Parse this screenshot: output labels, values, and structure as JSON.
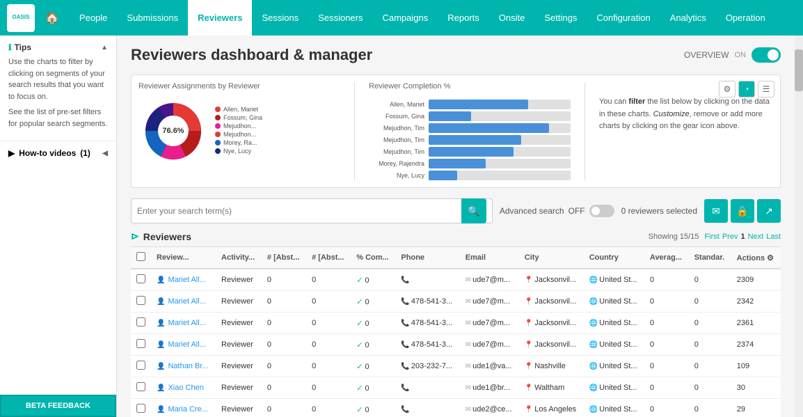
{
  "nav": {
    "logo": "OASIS",
    "home_icon": "🏠",
    "items": [
      {
        "label": "People",
        "active": false
      },
      {
        "label": "Submissions",
        "active": false
      },
      {
        "label": "Reviewers",
        "active": true
      },
      {
        "label": "Sessions",
        "active": false
      },
      {
        "label": "Sessioners",
        "active": false
      },
      {
        "label": "Campaigns",
        "active": false
      },
      {
        "label": "Reports",
        "active": false
      },
      {
        "label": "Onsite",
        "active": false
      },
      {
        "label": "Settings",
        "active": false
      },
      {
        "label": "Configuration",
        "active": false
      },
      {
        "label": "Analytics",
        "active": false
      },
      {
        "label": "Operation",
        "active": false
      }
    ]
  },
  "sidebar": {
    "tips_title": "Tips",
    "tips_text_1": "Use the charts to filter by clicking on segments of your search results that you want to focus on.",
    "tips_text_2": "See the list of pre-set filters for popular search segments.",
    "how_to_label": "How-to videos",
    "how_to_count": "(1)",
    "beta_feedback": "BETA FEEDBACK"
  },
  "page": {
    "title": "Reviewers dashboard & manager",
    "overview_label": "OVERVIEW",
    "toggle_on": true
  },
  "charts": {
    "pie_title": "Reviewer Assignments by Reviewer",
    "bar_title": "Reviewer Completion %",
    "pie_center_label": "76.6%",
    "legend": [
      {
        "name": "Allen, Mariet",
        "color": "#e53935"
      },
      {
        "name": "Fossum, Gina",
        "color": "#b71c1c"
      },
      {
        "name": "Mejudhon...",
        "color": "#e91e8c"
      },
      {
        "name": "Mejudhon...",
        "color": "#e53935"
      },
      {
        "name": "Morey, Ra...",
        "color": "#1565c0"
      },
      {
        "name": "Nye, Lucy",
        "color": "#1a237e"
      }
    ],
    "bars": [
      {
        "label": "Allen, Mariet",
        "pct": 70
      },
      {
        "label": "Fossum, Gina",
        "pct": 30
      },
      {
        "label": "Mejudhon, Tim",
        "pct": 85
      },
      {
        "label": "Mejudhon, Tim",
        "pct": 65
      },
      {
        "label": "Mejudhon, Tim",
        "pct": 60
      },
      {
        "label": "Morey, Rajendra",
        "pct": 40
      },
      {
        "label": "Nye, Lucy",
        "pct": 20
      }
    ],
    "info_text_1": "You can ",
    "info_filter": "filter",
    "info_text_2": " the list below by clicking on the data in these charts. ",
    "info_customize": "Customize",
    "info_text_3": ", remove or add more charts by clicking on the gear icon above."
  },
  "search": {
    "placeholder": "Enter your search term(s)",
    "advanced_label": "Advanced search",
    "advanced_toggle": "OFF",
    "selected_count": "0 reviewers selected"
  },
  "table": {
    "section_title": "Reviewers",
    "showing_label": "Showing 15/15",
    "pagination": {
      "first": "First",
      "prev": "Prev",
      "current": "1",
      "next": "Next",
      "last": "Last"
    },
    "columns": [
      "",
      "Review...",
      "Activity...",
      "# [Abst...",
      "# [Abst...",
      "% Com...",
      "Phone",
      "Email",
      "City",
      "Country",
      "Averag...",
      "Standar.",
      "Actions"
    ],
    "rows": [
      {
        "name": "Mariet All...",
        "activity": "Reviewer",
        "abs1": "0",
        "abs2": "0",
        "comp": "0",
        "phone": "",
        "email": "ude7@m...",
        "city": "Jacksonvil...",
        "country": "United St...",
        "avg": "0",
        "std": "0",
        "actions": "2309"
      },
      {
        "name": "Mariet All...",
        "activity": "Reviewer",
        "abs1": "0",
        "abs2": "0",
        "comp": "0",
        "phone": "478-541-3...",
        "email": "ude7@m...",
        "city": "Jacksonvil...",
        "country": "United St...",
        "avg": "0",
        "std": "0",
        "actions": "2342"
      },
      {
        "name": "Mariet All...",
        "activity": "Reviewer",
        "abs1": "0",
        "abs2": "0",
        "comp": "0",
        "phone": "478-541-3...",
        "email": "ude7@m...",
        "city": "Jacksonvil...",
        "country": "United St...",
        "avg": "0",
        "std": "0",
        "actions": "2361"
      },
      {
        "name": "Mariet All...",
        "activity": "Reviewer",
        "abs1": "0",
        "abs2": "0",
        "comp": "0",
        "phone": "478-541-3...",
        "email": "ude7@m...",
        "city": "Jacksonvil...",
        "country": "United St...",
        "avg": "0",
        "std": "0",
        "actions": "2374"
      },
      {
        "name": "Nathan Br...",
        "activity": "Reviewer",
        "abs1": "0",
        "abs2": "0",
        "comp": "0",
        "phone": "203-232-7...",
        "email": "ude1@va...",
        "city": "Nashville",
        "country": "United St...",
        "avg": "0",
        "std": "0",
        "actions": "109"
      },
      {
        "name": "Xiao Chen",
        "activity": "Reviewer",
        "abs1": "0",
        "abs2": "0",
        "comp": "0",
        "phone": "",
        "email": "ude1@br...",
        "city": "Waltham",
        "country": "United St...",
        "avg": "0",
        "std": "0",
        "actions": "30"
      },
      {
        "name": "Maria Cre...",
        "activity": "Reviewer",
        "abs1": "0",
        "abs2": "0",
        "comp": "0",
        "phone": "",
        "email": "ude2@ce...",
        "city": "Los Angeles",
        "country": "United St...",
        "avg": "0",
        "std": "0",
        "actions": "29"
      }
    ]
  }
}
